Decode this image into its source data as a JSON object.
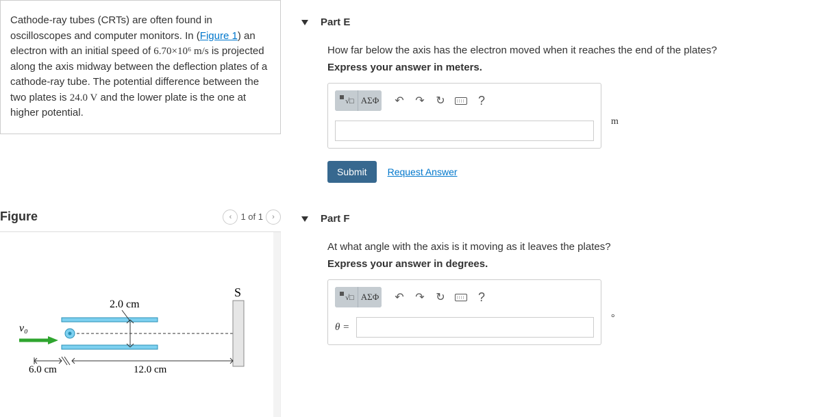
{
  "problem": {
    "text_before_link": "Cathode-ray tubes (CRTs) are often found in oscilloscopes and computer monitors. In (",
    "link_text": "Figure 1",
    "text_after_link": ") an electron with an initial speed of ",
    "speed": "6.70×10⁶ m/s",
    "text_after_speed": " is projected along the axis midway between the deflection plates of a cathode-ray tube. The potential difference between the two plates is ",
    "voltage": "24.0 V",
    "text_after_voltage": " and the lower plate is the one at higher potential."
  },
  "figure": {
    "title": "Figure",
    "nav_text": "1 of 1",
    "labels": {
      "gap": "2.0 cm",
      "v0": "v₀",
      "before": "6.0 cm",
      "length": "12.0 cm",
      "screen": "S"
    }
  },
  "partE": {
    "title": "Part E",
    "question": "How far below the axis has the electron moved when it reaches the end of the plates?",
    "instruction": "Express your answer in meters.",
    "greek": "ΑΣΦ",
    "unit": "m",
    "submit": "Submit",
    "request": "Request Answer",
    "help": "?"
  },
  "partF": {
    "title": "Part F",
    "question": "At what angle with the axis is it moving as it leaves the plates?",
    "instruction": "Express your answer in degrees.",
    "greek": "ΑΣΦ",
    "prefix": "θ =",
    "unit": "°",
    "help": "?"
  }
}
